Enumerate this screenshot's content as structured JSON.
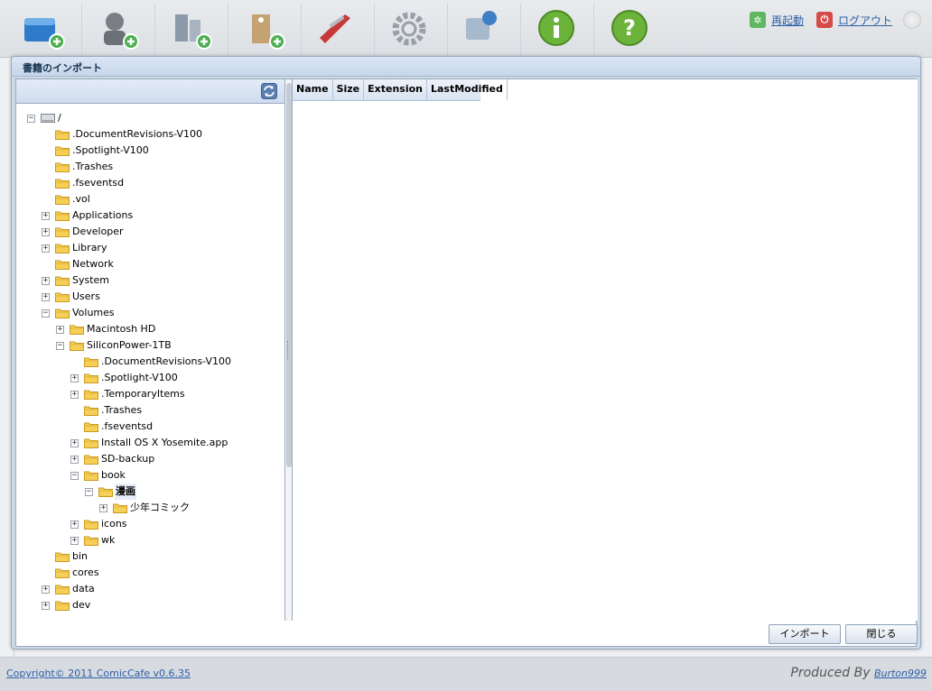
{
  "toolbar": {
    "buttons": [
      {
        "label": "インポート",
        "icon": "book-add-icon"
      },
      {
        "label": "著者",
        "icon": "author-add-icon"
      },
      {
        "label": "出版社",
        "icon": "publisher-add-icon"
      },
      {
        "label": "タグ",
        "icon": "tag-add-icon"
      },
      {
        "label": "ツール",
        "icon": "tools-icon"
      },
      {
        "label": "設定",
        "icon": "gear-icon"
      },
      {
        "label": "ダウンロード",
        "icon": "download-icon"
      },
      {
        "label": "情報",
        "icon": "info-icon"
      },
      {
        "label": "ヘルプ",
        "icon": "help-icon"
      }
    ],
    "restart_label": "再起動",
    "logout_label": "ログアウト"
  },
  "dialog": {
    "title": "書籍のインポート",
    "tree": [
      {
        "label": "/",
        "level": 0,
        "toggle": "-",
        "kind": "drive"
      },
      {
        "label": ".DocumentRevisions-V100",
        "level": 1,
        "toggle": ""
      },
      {
        "label": ".Spotlight-V100",
        "level": 1,
        "toggle": ""
      },
      {
        "label": ".Trashes",
        "level": 1,
        "toggle": ""
      },
      {
        "label": ".fseventsd",
        "level": 1,
        "toggle": ""
      },
      {
        "label": ".vol",
        "level": 1,
        "toggle": ""
      },
      {
        "label": "Applications",
        "level": 1,
        "toggle": "+"
      },
      {
        "label": "Developer",
        "level": 1,
        "toggle": "+"
      },
      {
        "label": "Library",
        "level": 1,
        "toggle": "+"
      },
      {
        "label": "Network",
        "level": 1,
        "toggle": ""
      },
      {
        "label": "System",
        "level": 1,
        "toggle": "+"
      },
      {
        "label": "Users",
        "level": 1,
        "toggle": "+"
      },
      {
        "label": "Volumes",
        "level": 1,
        "toggle": "-"
      },
      {
        "label": "Macintosh HD",
        "level": 2,
        "toggle": "+"
      },
      {
        "label": "SiliconPower-1TB",
        "level": 2,
        "toggle": "-"
      },
      {
        "label": ".DocumentRevisions-V100",
        "level": 3,
        "toggle": ""
      },
      {
        "label": ".Spotlight-V100",
        "level": 3,
        "toggle": "+"
      },
      {
        "label": ".TemporaryItems",
        "level": 3,
        "toggle": "+"
      },
      {
        "label": ".Trashes",
        "level": 3,
        "toggle": ""
      },
      {
        "label": ".fseventsd",
        "level": 3,
        "toggle": ""
      },
      {
        "label": "Install OS X Yosemite.app",
        "level": 3,
        "toggle": "+"
      },
      {
        "label": "SD-backup",
        "level": 3,
        "toggle": "+"
      },
      {
        "label": "book",
        "level": 3,
        "toggle": "-"
      },
      {
        "label": "漫画",
        "level": 4,
        "toggle": "-",
        "selected": true
      },
      {
        "label": "少年コミック",
        "level": 5,
        "toggle": "+"
      },
      {
        "label": "icons",
        "level": 3,
        "toggle": "+"
      },
      {
        "label": "wk",
        "level": 3,
        "toggle": "+"
      },
      {
        "label": "bin",
        "level": 1,
        "toggle": ""
      },
      {
        "label": "cores",
        "level": 1,
        "toggle": ""
      },
      {
        "label": "data",
        "level": 1,
        "toggle": "+"
      },
      {
        "label": "dev",
        "level": 1,
        "toggle": "+"
      }
    ],
    "columns": [
      "Name",
      "Size",
      "Extension",
      "LastModified"
    ],
    "import_button": "インポート",
    "close_button": "閉じる"
  },
  "footer": {
    "copyright": "Copyright© 2011 ComicCafe v0.6.35",
    "produced_by": "Produced By",
    "author": "Burton999"
  }
}
